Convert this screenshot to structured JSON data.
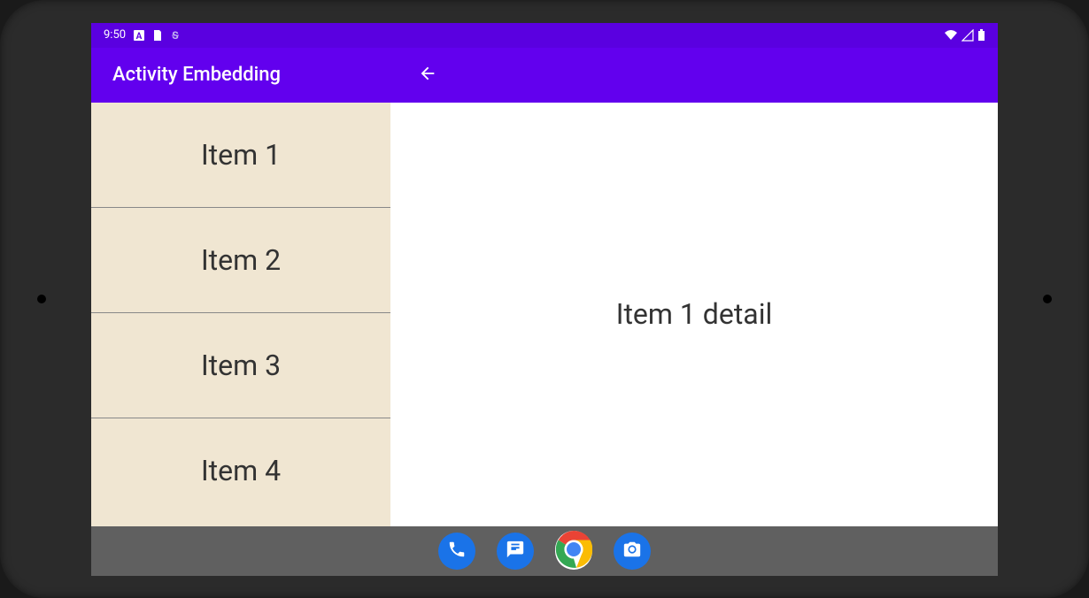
{
  "statusBar": {
    "time": "9:50",
    "indicators": [
      "A",
      "file",
      "S"
    ]
  },
  "appBar": {
    "title": "Activity Embedding"
  },
  "list": {
    "items": [
      {
        "label": "Item 1"
      },
      {
        "label": "Item 2"
      },
      {
        "label": "Item 3"
      },
      {
        "label": "Item 4"
      }
    ]
  },
  "detail": {
    "text": "Item 1 detail"
  },
  "navBar": {
    "apps": [
      "phone",
      "messages",
      "chrome",
      "camera"
    ]
  }
}
